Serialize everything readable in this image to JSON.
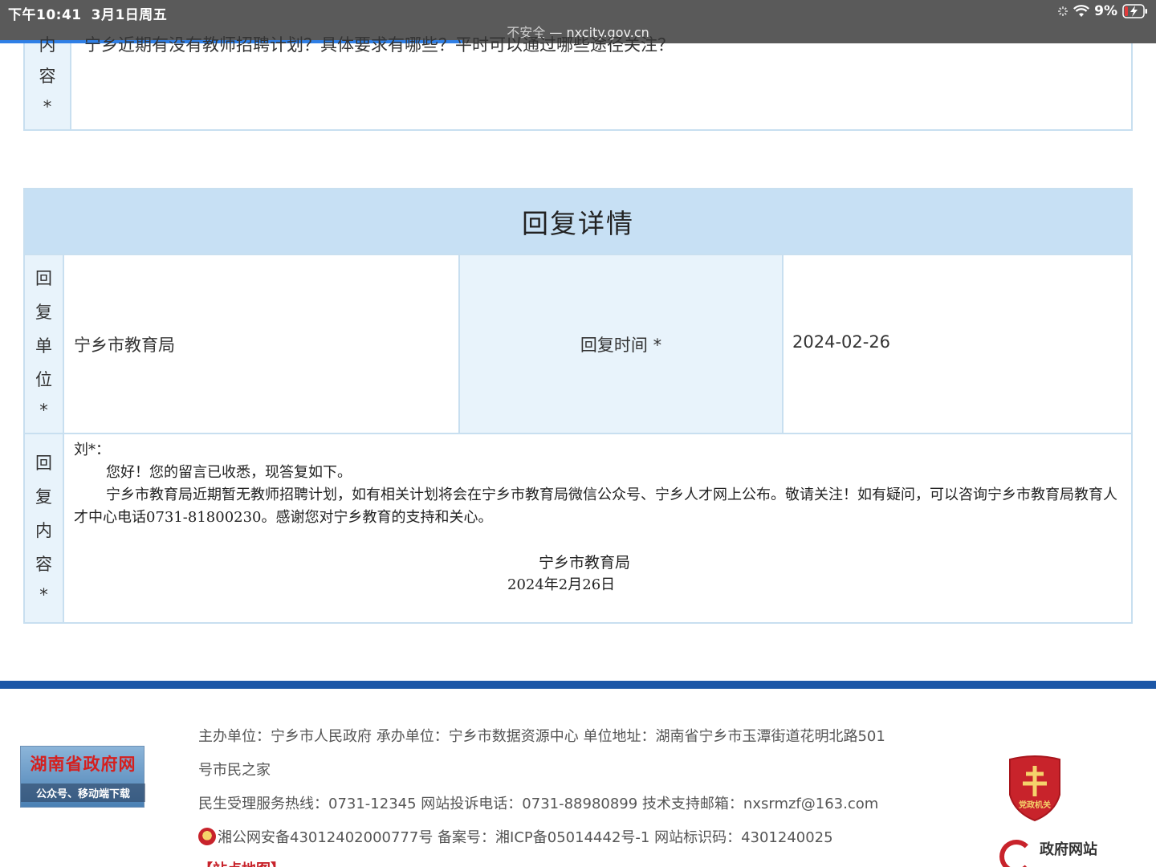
{
  "statusbar": {
    "time": "下午10:41",
    "date": "3月1日周五",
    "battery": "9%",
    "insecure": "不安全",
    "separator": "—",
    "url": "nxcity.gov.cn"
  },
  "question": {
    "label_chars": [
      "内",
      "容",
      "*"
    ],
    "text_fragment": "宁乡近期有没有教师招聘计划？具体要求有哪些？平时可以通过哪些途径关注？"
  },
  "reply": {
    "title": "回复详情",
    "unit_label_chars": [
      "回",
      "复",
      "单",
      "位",
      "*"
    ],
    "unit_value": "宁乡市教育局",
    "time_label": "回复时间 *",
    "time_value": "2024-02-26",
    "content_label_chars": [
      "回",
      "复",
      "内",
      "容",
      "*"
    ],
    "greeting": "刘*：",
    "para1": "您好！您的留言已收悉，现答复如下。",
    "para2": "宁乡市教育局近期暂无教师招聘计划，如有相关计划将会在宁乡市教育局微信公众号、宁乡人才网上公布。敬请关注！如有疑问，可以咨询宁乡市教育局教育人才中心电话0731-81800230。感谢您对宁乡教育的支持和关心。",
    "sign_org": "宁乡市教育局",
    "sign_date": "2024年2月26日"
  },
  "footer": {
    "line1": "主办单位：宁乡市人民政府 承办单位：宁乡市数据资源中心 单位地址：湖南省宁乡市玉潭街道花明北路501",
    "line2": "号市民之家",
    "line3": "民生受理服务热线：0731-12345 网站投诉电话：0731-88980899 技术支持邮箱：nxsrmzf@163.com",
    "line4": "湘公网安备43012402000777号 备案号：湘ICP备05014442号-1 网站标识码：4301240025",
    "map_link": "【站点地图】",
    "hunan_badge_title": "湖南省政府网",
    "hunan_badge_sub": "公众号、移动端下载",
    "party_badge": "党政机关",
    "gov_site": "政府网站"
  }
}
